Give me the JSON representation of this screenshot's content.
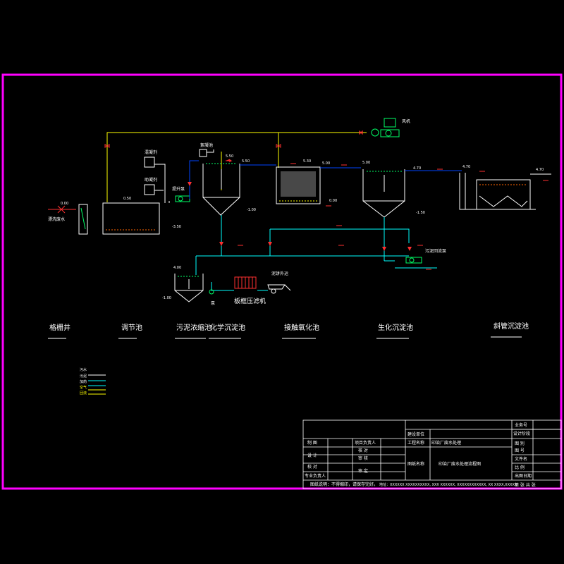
{
  "equipment": {
    "blower": "风机",
    "coagulant": "混凝剂",
    "flocculant": "助凝剂",
    "lift_pump": "提升泵",
    "dosing_tank": "絮凝池",
    "raw_water": "漂洗废水",
    "sludge_pump": "污泥回流泵",
    "filter_press": "板框压滤机",
    "sludge_cart": "泥饼外运",
    "pump_label": "泵"
  },
  "levels": {
    "grid_top": "0.00",
    "eq_top": "0.50",
    "eq_bottom": "-3.50",
    "chem_top": "5.50",
    "chem_bottom": "-1.00",
    "contact_left": "5.30",
    "contact_right": "5.00",
    "contact_base": "0.00",
    "bio_top": "5.00",
    "bio_right": "4.70",
    "bio_bottom": "-1.50",
    "incl_left": "4.70",
    "incl_right": "4.70",
    "thick_top": "4.00",
    "thick_bottom": "-1.00"
  },
  "process_units": [
    "格栅井",
    "调节池",
    "污泥浓缩池",
    "化学沉淀池",
    "接触氧化池",
    "生化沉淀池",
    "斜管沉淀池"
  ],
  "legend": [
    {
      "name": "污水",
      "color": "#ffffff"
    },
    {
      "name": "污泥",
      "color": "#00ffff"
    },
    {
      "name": "加药",
      "color": "#00ffff"
    },
    {
      "name": "空气",
      "color": "#ffff00"
    },
    {
      "name": "回流",
      "color": "#ffff00"
    }
  ],
  "title_block": {
    "owner_label": "业务号",
    "design_stage_label": "设计阶段",
    "design_unit_label": "建设单位",
    "project_name_label": "工程名称",
    "project_name": "印染厂废水处理",
    "drawing_title_label": "图纸名称",
    "drawing_title": "印染厂废水处理流程图",
    "drawn_label": "制 图",
    "project_lead_label": "项目负责人",
    "design_label": "设 计",
    "proofread_label": "校 对",
    "review_label": "审 核",
    "approve_label": "审 定",
    "check_label": "核 对",
    "tech_lead_label": "专业负责人",
    "figure_no_label": "图 号",
    "drawing_no_label": "图 别",
    "file_label": "文件名",
    "scale_label": "比 例",
    "date_label": "出图日期",
    "sheet_label": "第 张 共 张",
    "note_label": "图纸说明：不得缩印，请保存完好。",
    "address": "地址：XXXXXX XXXXXXXXXX, XXX XXXXXX, XXXXXXXXXXXX, XX XXXX,XXXXX"
  }
}
